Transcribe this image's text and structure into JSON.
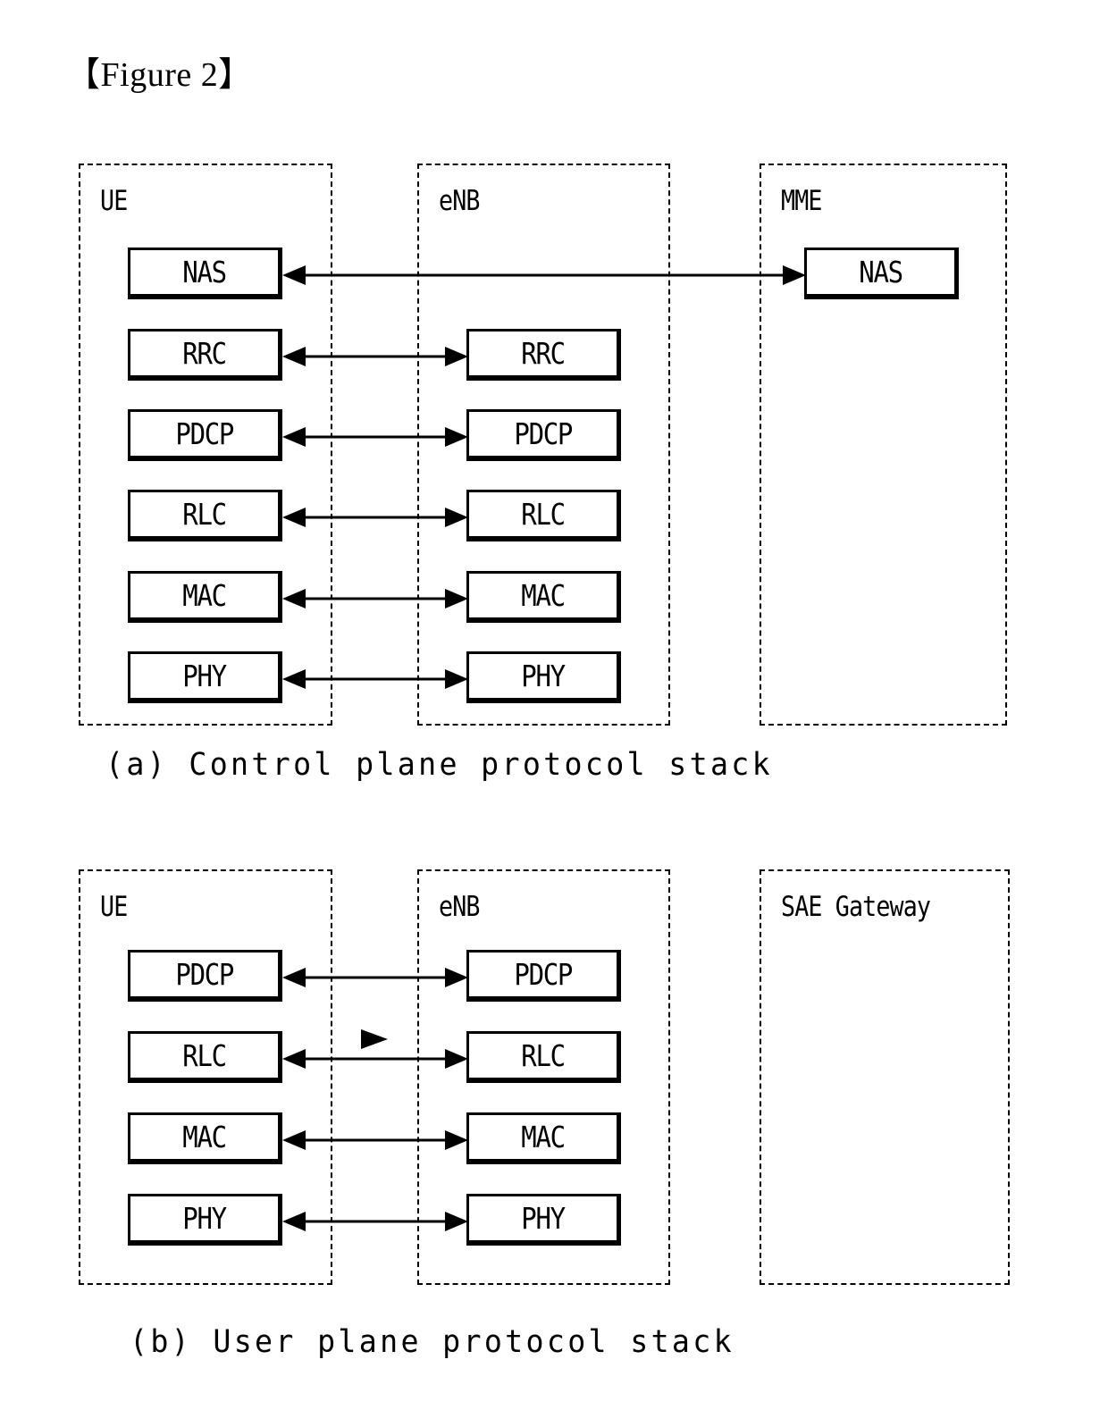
{
  "figure": {
    "title": "【Figure 2】"
  },
  "diagrams": [
    {
      "id": "control-plane",
      "caption": "(a) Control plane protocol stack",
      "containers": [
        {
          "name": "ue",
          "label": "UE"
        },
        {
          "name": "enb",
          "label": "eNB"
        },
        {
          "name": "mme",
          "label": "MME"
        }
      ],
      "ue_layers": [
        "NAS",
        "RRC",
        "PDCP",
        "RLC",
        "MAC",
        "PHY"
      ],
      "enb_layers": [
        "RRC",
        "PDCP",
        "RLC",
        "MAC",
        "PHY"
      ],
      "mme_layers": [
        "NAS"
      ],
      "connections": [
        {
          "name": "nas-link",
          "from": "ue-nas",
          "to": "mme-nas",
          "style": "double-arrow"
        },
        {
          "name": "rrc-link",
          "from": "ue-rrc",
          "to": "enb-rrc",
          "style": "double-arrow"
        },
        {
          "name": "pdcp-link",
          "from": "ue-pdcp",
          "to": "enb-pdcp",
          "style": "double-arrow"
        },
        {
          "name": "rlc-link",
          "from": "ue-rlc",
          "to": "enb-rlc",
          "style": "double-arrow"
        },
        {
          "name": "mac-link",
          "from": "ue-mac",
          "to": "enb-mac",
          "style": "double-arrow"
        },
        {
          "name": "phy-link",
          "from": "ue-phy",
          "to": "enb-phy",
          "style": "double-arrow"
        }
      ]
    },
    {
      "id": "user-plane",
      "caption": "(b) User plane protocol stack",
      "containers": [
        {
          "name": "ue",
          "label": "UE"
        },
        {
          "name": "enb",
          "label": "eNB"
        },
        {
          "name": "sae",
          "label": "SAE Gateway"
        }
      ],
      "ue_layers": [
        "PDCP",
        "RLC",
        "MAC",
        "PHY"
      ],
      "enb_layers": [
        "PDCP",
        "RLC",
        "MAC",
        "PHY"
      ],
      "sae_layers": [],
      "connections": [
        {
          "name": "pdcp-link",
          "from": "ue-pdcp",
          "to": "enb-pdcp",
          "style": "double-arrow"
        },
        {
          "name": "rlc-link",
          "from": "ue-rlc",
          "to": "enb-rlc",
          "style": "double-arrow"
        },
        {
          "name": "mac-link",
          "from": "ue-mac",
          "to": "enb-mac",
          "style": "double-arrow"
        },
        {
          "name": "phy-link",
          "from": "ue-phy",
          "to": "enb-phy",
          "style": "double-arrow"
        }
      ]
    }
  ],
  "colors": {
    "stroke": "#000000",
    "background": "#ffffff"
  }
}
